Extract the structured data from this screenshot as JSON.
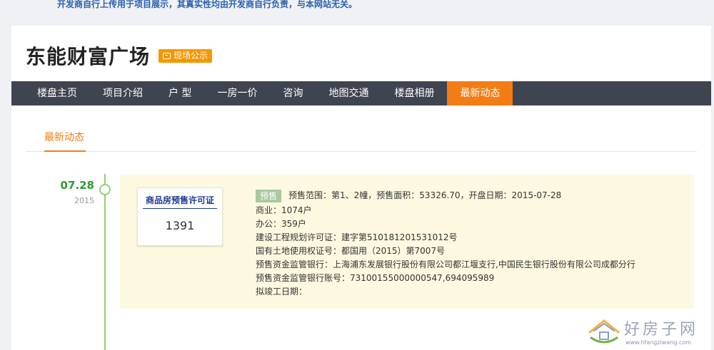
{
  "disclaimer": "开发商自行上传用于项目展示，其真实性均由开发商自行负责，与本网站无关。",
  "project": {
    "title": "东能财富广场",
    "badge": "现场公示"
  },
  "nav": {
    "items": [
      "楼盘主页",
      "项目介绍",
      "户 型",
      "一房一价",
      "咨询",
      "地图交通",
      "楼盘相册",
      "最新动态"
    ],
    "active_index": 7
  },
  "subtab": {
    "label": "最新动态"
  },
  "timeline": {
    "entry": {
      "date_md": "07.28",
      "year": "2015",
      "permit_title": "商品房预售许可证",
      "permit_number": "1391",
      "badge": "预售",
      "lines": [
        "预售范围：第1、2幢，预售面积：53326.70，开盘日期：2015-07-28",
        "商业：1074户",
        "办公：359户",
        "建设工程规划许可证：建字第510181201531012号",
        "国有土地使用权证号：都国用（2015）第7007号",
        "预售资金监管银行：上海浦东发展银行股份有限公司都江堰支行,中国民生银行股份有限公司成都分行",
        "预售资金监管银行账号：73100155000000547,694095989",
        "拟竣工日期："
      ]
    }
  },
  "watermark": {
    "text": "好房子网",
    "url": "www.hfangziwang.com"
  },
  "colors": {
    "accent": "#f37c14",
    "nav_bg": "#3e4450",
    "timeline_green": "#8fd076",
    "card_bg": "#fdf9e0",
    "permit_blue": "#1f3a93"
  }
}
